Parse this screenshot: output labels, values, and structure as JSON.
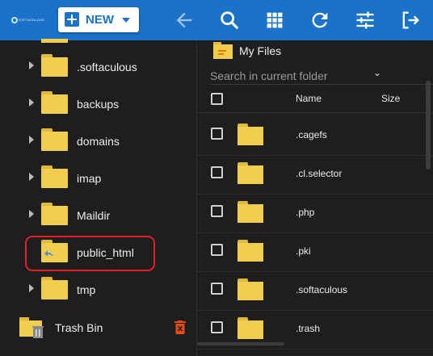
{
  "toolbar": {
    "brand_text": "SOFTACULOUS",
    "new_label": "NEW",
    "icons": [
      "back-icon",
      "search-icon",
      "grid-view-icon",
      "refresh-icon",
      "settings-sliders-icon",
      "logout-icon"
    ]
  },
  "tree": {
    "items": [
      {
        "label": ".softaculous"
      },
      {
        "label": "backups"
      },
      {
        "label": "domains"
      },
      {
        "label": "imap"
      },
      {
        "label": "Maildir"
      },
      {
        "label": "public_html"
      },
      {
        "label": "tmp"
      }
    ],
    "trash_label": "Trash Bin"
  },
  "pane": {
    "title": "My Files",
    "search_placeholder": "Search in current folder",
    "columns": {
      "name": "Name",
      "size": "Size"
    },
    "rows": [
      {
        "name": ".cagefs"
      },
      {
        "name": ".cl.selector"
      },
      {
        "name": ".php"
      },
      {
        "name": ".pki"
      },
      {
        "name": ".softaculous"
      },
      {
        "name": ".trash"
      }
    ]
  },
  "colors": {
    "topbar": "#1a73c9",
    "folder": "#f1cd4f",
    "highlight": "#e0202a",
    "trash_delete": "#e64a19"
  }
}
